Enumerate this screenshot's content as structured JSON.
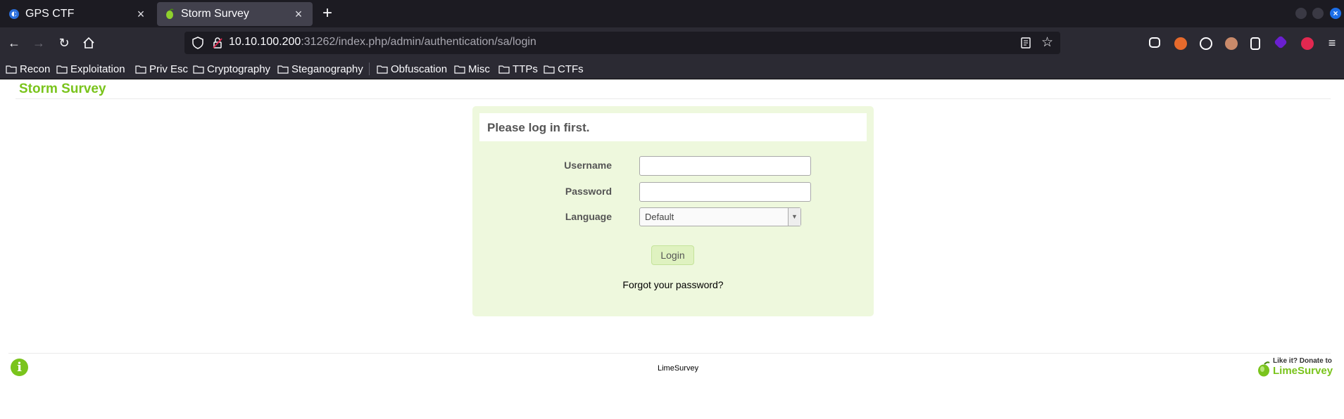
{
  "browser": {
    "tabs": [
      {
        "title": "GPS CTF",
        "icon": "firefox-icon"
      },
      {
        "title": "Storm Survey",
        "icon": "limesurvey-favicon"
      }
    ],
    "url_host": "10.10.100.200",
    "url_rest": ":31262/index.php/admin/authentication/sa/login",
    "bookmarks": [
      "Recon",
      "Exploitation",
      "Priv Esc",
      "Cryptography",
      "Steganography",
      "Obfuscation",
      "Misc",
      "TTPs",
      "CTFs"
    ]
  },
  "page": {
    "site_title": "Storm Survey",
    "login_message": "Please log in first.",
    "username_label": "Username",
    "password_label": "Password",
    "language_label": "Language",
    "language_value": "Default",
    "login_button": "Login",
    "forgot_password": "Forgot your password?",
    "footer_center": "LimeSurvey",
    "donate_line1": "Like it? Donate to",
    "donate_line2": "LimeSurvey"
  },
  "colors": {
    "accent": "#7ac41c",
    "login_bg": "#eef8dd",
    "chrome_dark": "#1c1b22"
  }
}
